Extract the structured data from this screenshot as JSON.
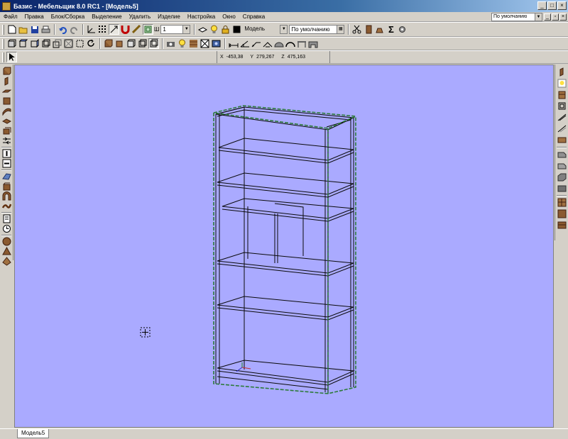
{
  "window": {
    "title": "Базис - Мебельщик 8.0 RC1 - [Модель5]",
    "buttons": [
      "_",
      "□",
      "×"
    ]
  },
  "menu": {
    "items": [
      "Файл",
      "Правка",
      "Блок/Сборка",
      "Выделение",
      "Удалить",
      "Изделие",
      "Настройка",
      "Окно",
      "Справка"
    ],
    "view_select": "По умолчанию"
  },
  "toolbar_main": {
    "step_label": "Ш",
    "step_value": "1",
    "layer_value": "Модель",
    "linetype_value": "По умолчанию",
    "sum_glyph": "Σ"
  },
  "coords": {
    "x_label": "X",
    "x_value": "-453,38",
    "y_label": "Y",
    "y_value": "279,267",
    "z_label": "Z",
    "z_value": "475,163"
  },
  "tabs": {
    "active": "Модель5"
  },
  "colors": {
    "viewport_bg": "#aaaaff",
    "selection_outline": "#2d7a3a",
    "wireframe": "#101010",
    "title_bar": "#0a246a"
  }
}
